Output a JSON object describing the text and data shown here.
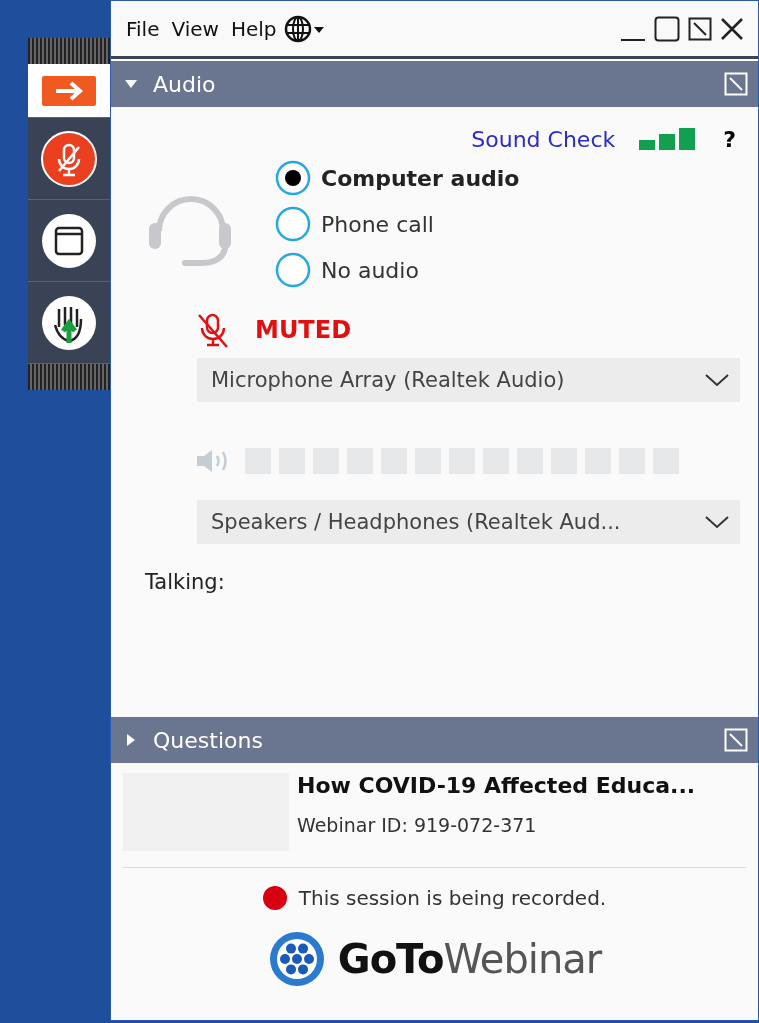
{
  "menu": [
    "File",
    "View",
    "Help"
  ],
  "audio": {
    "title": "Audio",
    "expanded": true,
    "sound_check": "Sound Check",
    "help": "?",
    "options": [
      {
        "label": "Computer audio",
        "selected": true
      },
      {
        "label": "Phone call",
        "selected": false
      },
      {
        "label": "No audio",
        "selected": false
      }
    ],
    "muted": true,
    "muted_label": "MUTED",
    "microphone": "Microphone Array (Realtek Audio)",
    "speakers": "Speakers / Headphones (Realtek Aud...",
    "talking_label": "Talking:"
  },
  "questions": {
    "title": "Questions",
    "expanded": false
  },
  "webinar": {
    "title": "How COVID-19 Affected Educa...",
    "id": "Webinar ID: 919-072-371",
    "recording": "This session is being recorded.",
    "brand": "**GoTo**Webinar"
  }
}
